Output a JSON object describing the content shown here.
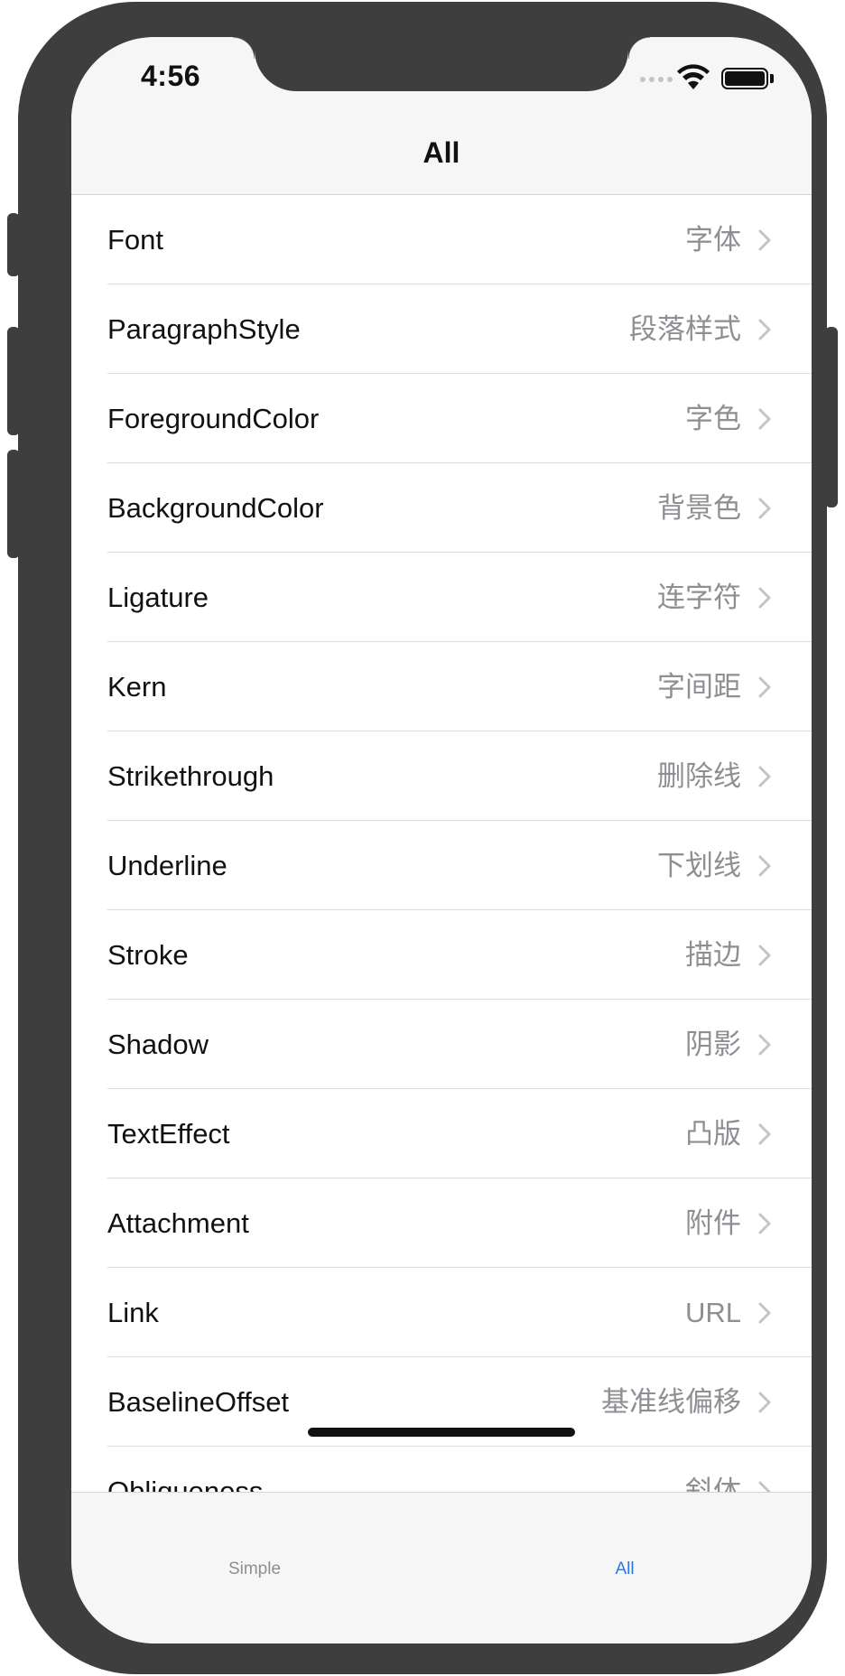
{
  "status_bar": {
    "time": "4:56"
  },
  "nav": {
    "title": "All"
  },
  "rows": [
    {
      "title": "Font",
      "detail": "字体"
    },
    {
      "title": "ParagraphStyle",
      "detail": "段落样式"
    },
    {
      "title": "ForegroundColor",
      "detail": "字色"
    },
    {
      "title": "BackgroundColor",
      "detail": "背景色"
    },
    {
      "title": "Ligature",
      "detail": "连字符"
    },
    {
      "title": "Kern",
      "detail": "字间距"
    },
    {
      "title": "Strikethrough",
      "detail": "删除线"
    },
    {
      "title": "Underline",
      "detail": "下划线"
    },
    {
      "title": "Stroke",
      "detail": "描边"
    },
    {
      "title": "Shadow",
      "detail": "阴影"
    },
    {
      "title": "TextEffect",
      "detail": "凸版"
    },
    {
      "title": "Attachment",
      "detail": "附件"
    },
    {
      "title": "Link",
      "detail": "URL"
    },
    {
      "title": "BaselineOffset",
      "detail": "基准线偏移"
    },
    {
      "title": "Obliqueness",
      "detail": "斜体"
    }
  ],
  "tabbar": {
    "tabs": [
      {
        "label": "Simple",
        "selected": false
      },
      {
        "label": "All",
        "selected": true
      }
    ],
    "selected_color": "#2a7ae2",
    "unselected_color": "#8e8e93"
  }
}
